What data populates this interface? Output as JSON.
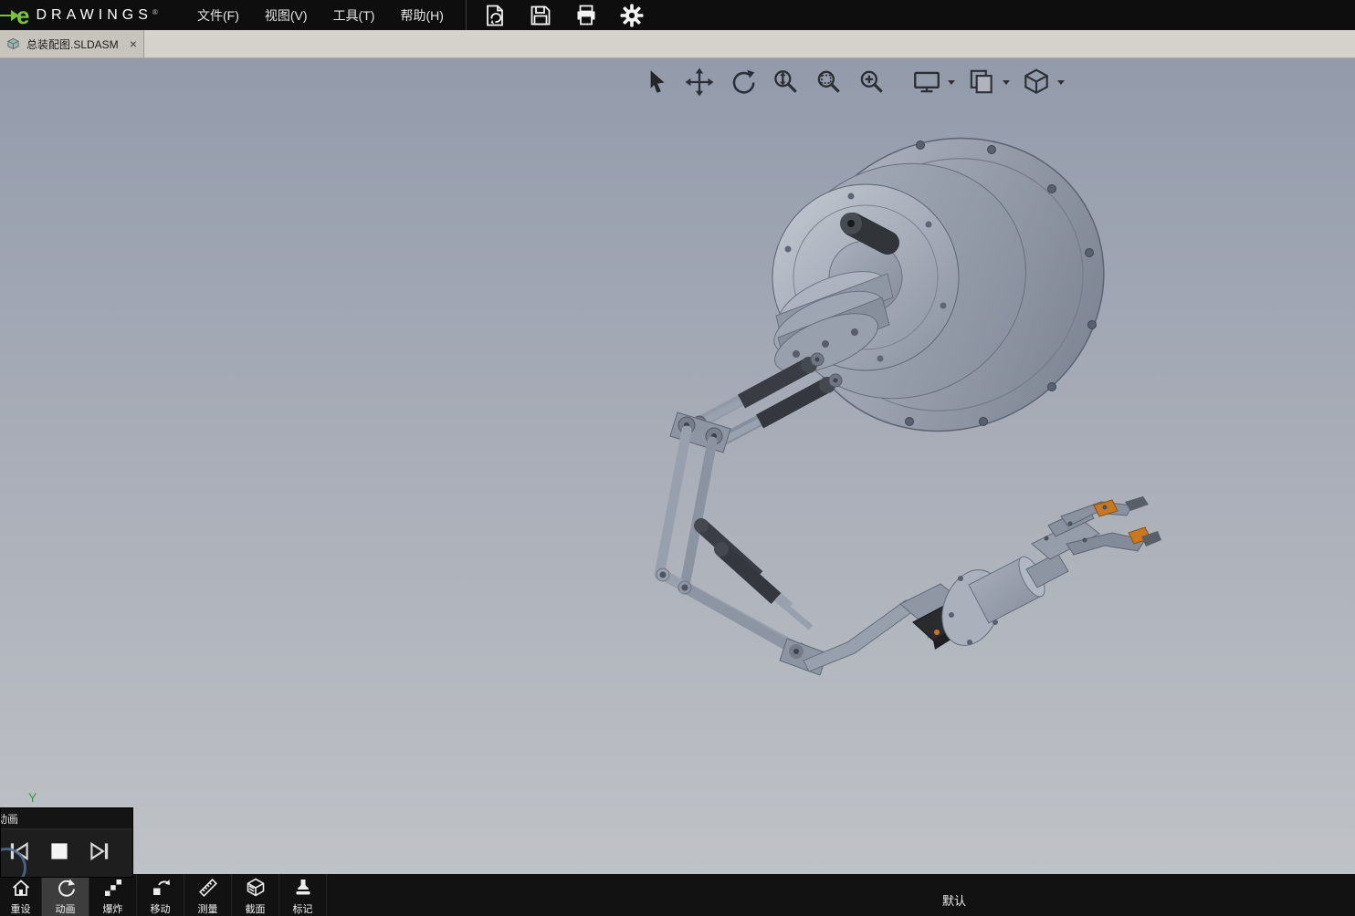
{
  "app": {
    "brand_e": "e",
    "brand_name": "DRAWINGS",
    "brand_reg": "®"
  },
  "menu_items": [
    {
      "label": "文件(F)"
    },
    {
      "label": "视图(V)"
    },
    {
      "label": "工具(T)"
    },
    {
      "label": "帮助(H)"
    }
  ],
  "quick_icons": [
    {
      "name": "open"
    },
    {
      "name": "save"
    },
    {
      "name": "print"
    },
    {
      "name": "settings"
    }
  ],
  "tab": {
    "title": "总装配图.SLDASM",
    "close_glyph": "×"
  },
  "view_toolbar": {
    "icons": [
      "select",
      "pan",
      "rotate",
      "zoom",
      "zoom-area",
      "zoom-fit",
      "fullscreen",
      "display-options",
      "view-orientation"
    ]
  },
  "viewport": {
    "axis_y_label": "Y"
  },
  "animation_panel": {
    "title": "动画",
    "buttons": [
      "skip-to-start",
      "stop",
      "skip-to-end"
    ]
  },
  "bottom_toolbar": {
    "items": [
      {
        "label": "重设",
        "active": false
      },
      {
        "label": "动画",
        "active": true
      },
      {
        "label": "爆炸",
        "active": false
      },
      {
        "label": "移动",
        "active": false
      },
      {
        "label": "测量",
        "active": false
      },
      {
        "label": "截面",
        "active": false
      },
      {
        "label": "标记",
        "active": false
      }
    ],
    "config_label": "默认"
  },
  "colors": {
    "brand_green": "#7ac143",
    "menubar_bg": "#0e0e0e",
    "tabbar_bg": "#d5d2cb",
    "viewport_gradient_top": "#939bab",
    "viewport_gradient_bottom": "#bfc2c6",
    "metal_gray": "#98a0ae",
    "cylinder_dark": "#36393f",
    "accent_orange": "#c8781f",
    "axis_green": "#2e9e3a"
  }
}
